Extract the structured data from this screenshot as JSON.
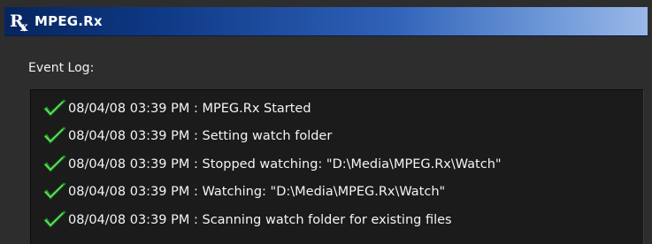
{
  "window": {
    "title": "MPEG.Rx"
  },
  "event_log": {
    "label": "Event Log:",
    "entries": [
      {
        "text": "08/04/08 03:39 PM : MPEG.Rx Started",
        "status_icon": "green-checkmark"
      },
      {
        "text": "08/04/08 03:39 PM : Setting watch folder",
        "status_icon": "green-checkmark"
      },
      {
        "text": "08/04/08 03:39 PM : Stopped watching: \"D:\\Media\\MPEG.Rx\\Watch\"",
        "status_icon": "green-checkmark"
      },
      {
        "text": "08/04/08 03:39 PM : Watching: \"D:\\Media\\MPEG.Rx\\Watch\"",
        "status_icon": "green-checkmark"
      },
      {
        "text": "08/04/08 03:39 PM : Scanning watch folder for existing files",
        "status_icon": "green-checkmark"
      }
    ]
  },
  "colors": {
    "title_gradient_start": "#06255f",
    "title_gradient_end": "#9ab8e8",
    "panel_background": "#2d2d2d",
    "log_background": "#1b1b1b",
    "check_green": "#2fb52f"
  }
}
